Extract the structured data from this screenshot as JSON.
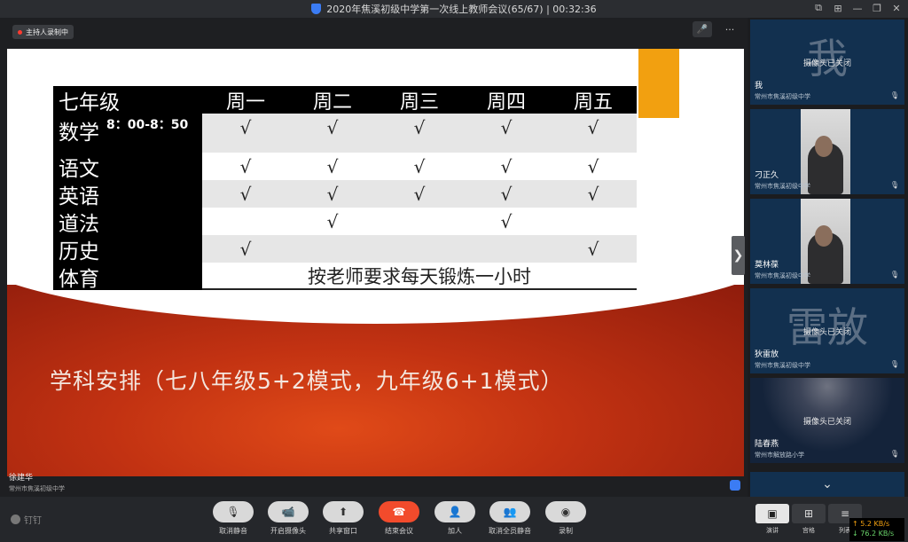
{
  "window": {
    "title": "2020年焦溪初级中学第一次线上教师会议(65/67) | 00:32:36",
    "controls": [
      "⧉",
      "⊞",
      "—",
      "❐",
      "✕"
    ]
  },
  "stage": {
    "record_badge": "主持人录制中",
    "speaker_name": "徐建华",
    "speaker_school": "常州市焦溪初级中学"
  },
  "slide": {
    "table": {
      "corner": "七年级",
      "days": [
        "周一",
        "周二",
        "周三",
        "周四",
        "周五"
      ],
      "rows": [
        {
          "subject": "数学",
          "time": "8：00-8：50",
          "marks": [
            "√",
            "√",
            "√",
            "√",
            "√"
          ]
        },
        {
          "subject": "语文",
          "time": "",
          "marks": [
            "√",
            "√",
            "√",
            "√",
            "√"
          ]
        },
        {
          "subject": "英语",
          "time": "",
          "marks": [
            "√",
            "√",
            "√",
            "√",
            "√"
          ]
        },
        {
          "subject": "道法",
          "time": "",
          "marks": [
            "",
            "√",
            "",
            "√",
            ""
          ]
        },
        {
          "subject": "历史",
          "time": "",
          "marks": [
            "√",
            "",
            "",
            "",
            "√"
          ]
        }
      ],
      "pe_subject": "体育",
      "pe_note": "按老师要求每天锻炼一小时"
    },
    "caption": "学科安排（七八年级5+2模式，九年级6+1模式）"
  },
  "participants": [
    {
      "name": "我",
      "school": "常州市焦溪初级中学",
      "big_char": "我",
      "status": "摄像头已关闭"
    },
    {
      "name": "刁正久",
      "school": "常州市焦溪初级中学"
    },
    {
      "name": "莫林葆",
      "school": "常州市焦溪初级中学"
    },
    {
      "name": "狄雷放",
      "school": "常州市焦溪初级中学",
      "big_char": "雷放",
      "status": "摄像头已关闭"
    },
    {
      "name": "陆春燕",
      "school": "常州市解放路小学",
      "status": "摄像头已关闭"
    }
  ],
  "toolbar": {
    "brand": "钉钉",
    "buttons": [
      {
        "label": "取消静音",
        "icon": "🎙"
      },
      {
        "label": "开启摄像头",
        "icon": "📹"
      },
      {
        "label": "共享窗口",
        "icon": "⬆"
      },
      {
        "label": "结束会议",
        "icon": "☎"
      },
      {
        "label": "加人",
        "icon": "👤"
      },
      {
        "label": "取消全员静音",
        "icon": "👥"
      },
      {
        "label": "录制",
        "icon": "◉"
      }
    ],
    "views": [
      {
        "label": "演讲",
        "icon": "▣"
      },
      {
        "label": "宫格",
        "icon": "⊞"
      },
      {
        "label": "列表",
        "icon": "≡"
      }
    ]
  },
  "network": {
    "up": "↑ 5.2 KB/s",
    "down": "↓ 76.2 KB/s"
  }
}
